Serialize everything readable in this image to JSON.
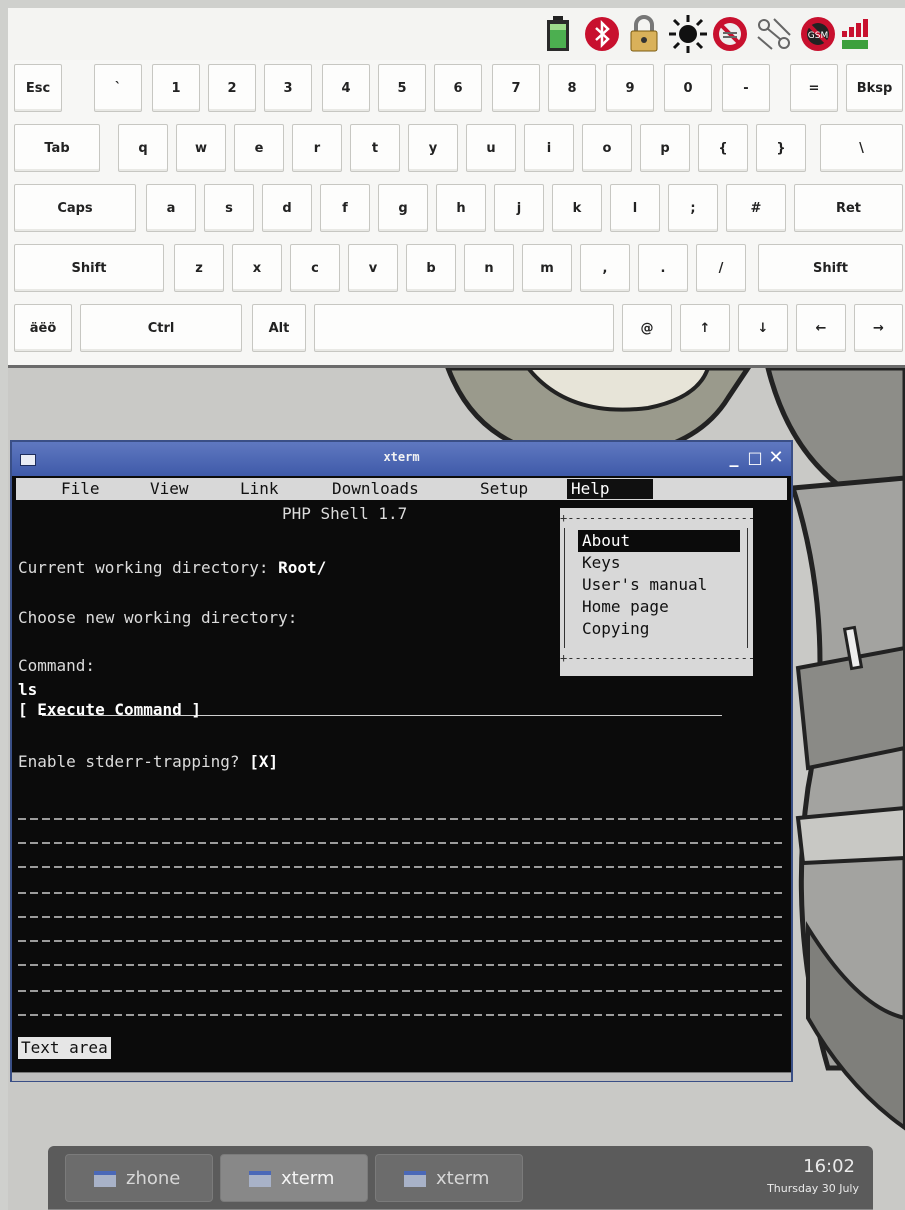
{
  "status_icons": [
    "battery-icon",
    "bluetooth-icon",
    "lock-icon",
    "brightness-icon",
    "wifi-off-icon",
    "network-icon",
    "gsm-off-icon",
    "signal-icon"
  ],
  "keyboard": {
    "rows": [
      [
        "Esc",
        "`",
        "1",
        "2",
        "3",
        "4",
        "5",
        "6",
        "7",
        "8",
        "9",
        "0",
        "-",
        "=",
        "Bksp"
      ],
      [
        "Tab",
        "q",
        "w",
        "e",
        "r",
        "t",
        "y",
        "u",
        "i",
        "o",
        "p",
        "{",
        "}",
        "\\"
      ],
      [
        "Caps",
        "a",
        "s",
        "d",
        "f",
        "g",
        "h",
        "j",
        "k",
        "l",
        ";",
        "#",
        "Ret"
      ],
      [
        "Shift",
        "z",
        "x",
        "c",
        "v",
        "b",
        "n",
        "m",
        ",",
        ".",
        "/",
        "Shift"
      ],
      [
        "äëö",
        "Ctrl",
        "Alt",
        "",
        "@",
        "↑",
        "↓",
        "←",
        "→"
      ]
    ]
  },
  "xterm": {
    "title": "xterm",
    "menu": [
      "File",
      "View",
      "Link",
      "Downloads",
      "Setup",
      "Help"
    ],
    "help_menu": [
      "About",
      "Keys",
      "User's manual",
      "Home page",
      "Copying"
    ],
    "shell_title": "PHP Shell 1.7",
    "cwd_label": "Current working directory: ",
    "cwd_value": "Root/",
    "choose_dir": "Choose new working directory:",
    "command_label": "Command:",
    "command_value": "ls",
    "execute_button": "[ Execute Command ]",
    "stderr_label": "Enable stderr-trapping? ",
    "stderr_value": "[X]",
    "text_area": "Text area"
  },
  "taskbar": {
    "tasks": [
      {
        "label": "zhone",
        "active": false
      },
      {
        "label": "xterm",
        "active": true
      },
      {
        "label": "xterm",
        "active": false
      }
    ],
    "time": "16:02",
    "date": "Thursday 30 July"
  }
}
